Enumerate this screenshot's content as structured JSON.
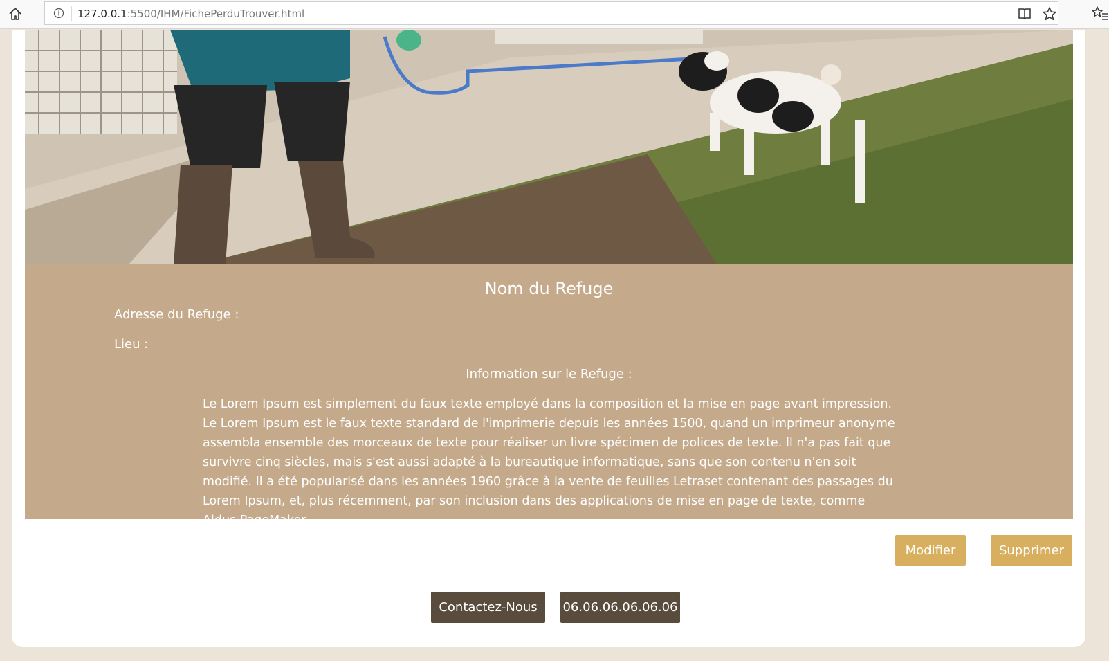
{
  "browser": {
    "url_host": "127.0.0.1",
    "url_path": ":5500/IHM/FichePerduTrouver.html"
  },
  "icons": {
    "home": "home-icon",
    "info": "info-icon",
    "reader": "reader-view-icon",
    "star": "star-icon",
    "favorites": "favorites-icon"
  },
  "refuge": {
    "name": "Nom du Refuge",
    "address_label": "Adresse du Refuge :",
    "lieu_label": "Lieu :",
    "info_title": "Information sur le Refuge :",
    "description": "Le Lorem Ipsum est simplement du faux texte employé dans la composition et la mise en page avant impression. Le Lorem Ipsum est le faux texte standard de l'imprimerie depuis les années 1500, quand un imprimeur anonyme assembla ensemble des morceaux de texte pour réaliser un livre spécimen de polices de texte. Il n'a pas fait que survivre cinq siècles, mais s'est aussi adapté à la bureautique informatique, sans que son contenu n'en soit modifié. Il a été popularisé dans les années 1960 grâce à la vente de feuilles Letraset contenant des passages du Lorem Ipsum, et, plus récemment, par son inclusion dans des applications de mise en page de texte, comme Aldus PageMaker."
  },
  "actions": {
    "modifier": "Modifier",
    "supprimer": "Supprimer",
    "contact": "Contactez-Nous",
    "phone": "06.06.06.06.06.06"
  },
  "colors": {
    "page_background": "#ece3d9",
    "panel": "#c4aa8b",
    "button_gold": "#d8af5e",
    "button_dark": "#5a4c3d"
  }
}
